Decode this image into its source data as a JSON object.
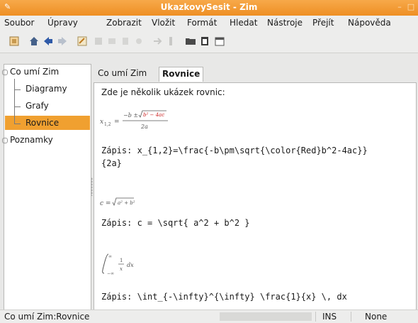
{
  "window": {
    "title": "UkazkovySesit - Zim",
    "app_icon": "zim-icon"
  },
  "menu": [
    "Soubor",
    "Úpravy",
    "Zobrazit",
    "Vložit",
    "Formát",
    "Hledat",
    "Nástroje",
    "Přejít",
    "Nápověda"
  ],
  "toolbar": {
    "icons": [
      "notebook-icon",
      "home-icon",
      "back-icon",
      "forward-icon",
      "edit-icon",
      "bold-icon",
      "link-icon",
      "print-icon",
      "attach-icon",
      "arrow-icon",
      "pen-icon",
      "folder-icon",
      "clipboard-icon",
      "calendar-icon"
    ]
  },
  "sidebar": {
    "items": [
      {
        "label": "Co umí Zim",
        "level": 0,
        "expanded": true
      },
      {
        "label": "Diagramy",
        "level": 1
      },
      {
        "label": "Grafy",
        "level": 1
      },
      {
        "label": "Rovnice",
        "level": 1,
        "selected": true
      },
      {
        "label": "Poznamky",
        "level": 0,
        "expanded": false
      }
    ]
  },
  "tabs": [
    {
      "label": "Co umí Zim",
      "active": false
    },
    {
      "label": "Rovnice",
      "active": true
    }
  ],
  "page": {
    "intro": "Zde je několik ukázek rovnic:",
    "equations": [
      {
        "render": "x₁,₂ = (−b ± √(b² − 4ac)) / 2a",
        "label": "Zápis:",
        "source_line1": "x_{1,2}=\\frac{-b\\pm\\sqrt{\\color{Red}b^2-4ac}}",
        "source_line2": "{2a}"
      },
      {
        "render": "c = √(a² + b²)",
        "label": "Zápis:",
        "source_line1": "c = \\sqrt{ a^2 + b^2 }"
      },
      {
        "render": "∫₋∞^∞ 1/x dx",
        "label": "Zápis:",
        "source_line1": "\\int_{-\\infty}^{\\infty} \\frac{1}{x} \\, dx"
      }
    ]
  },
  "status": {
    "path": "Co umí Zim:Rovnice",
    "mode": "INS",
    "style": "None"
  },
  "colors": {
    "title_bar": "#ee8f24",
    "selection": "#f0a030",
    "equation_red": "#cc2222"
  }
}
